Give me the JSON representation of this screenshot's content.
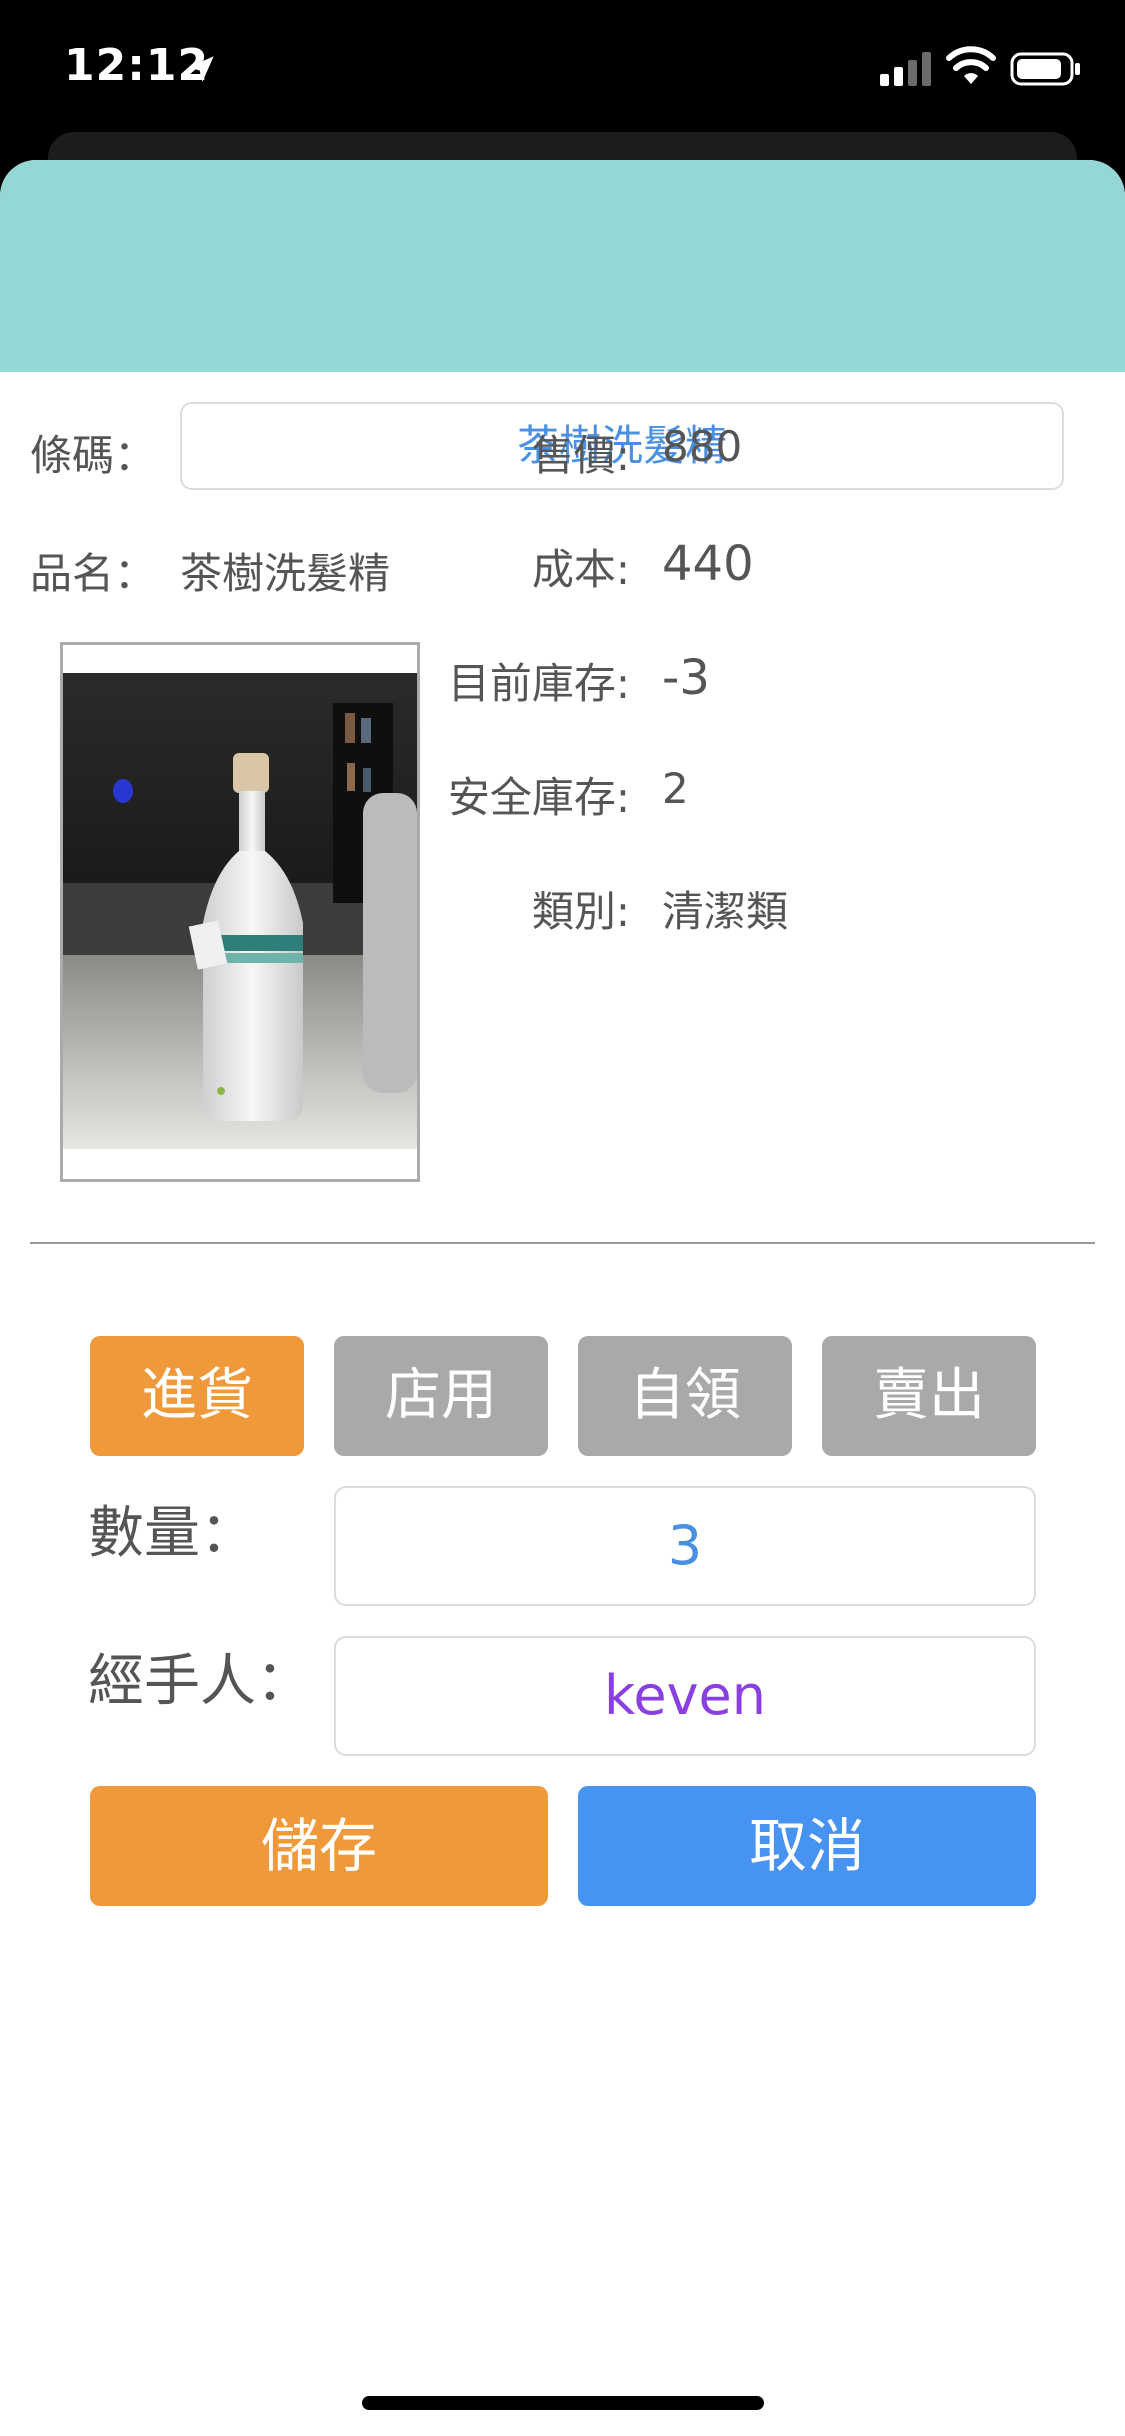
{
  "status_bar": {
    "time": "12:12"
  },
  "form": {
    "barcode_label": "條碼：",
    "barcode_value": "茶樹洗髮精",
    "name_label": "品名：",
    "name_value": "茶樹洗髮精"
  },
  "product_info": [
    {
      "key": "售價:",
      "value": "880"
    },
    {
      "key": "成本:",
      "value": "440"
    },
    {
      "key": "目前庫存:",
      "value": "-3"
    },
    {
      "key": "安全庫存:",
      "value": "2"
    },
    {
      "key": "類別:",
      "value": "清潔類"
    }
  ],
  "transaction_types": [
    {
      "label": "進貨",
      "selected": true
    },
    {
      "label": "店用",
      "selected": false
    },
    {
      "label": "自領",
      "selected": false
    },
    {
      "label": "賣出",
      "selected": false
    }
  ],
  "quantity": {
    "label": "數量：",
    "value": "3"
  },
  "handler": {
    "label": "經手人：",
    "value": "keven"
  },
  "actions": {
    "save_label": "儲存",
    "cancel_label": "取消"
  },
  "colors": {
    "header": "#94d7d4",
    "active_button": "#f0993a",
    "inactive_button": "#a9a9a9",
    "save_button": "#f0993a",
    "cancel_button": "#4793f2",
    "barcode_text": "#4a90e2",
    "quantity_text": "#4a90e2",
    "handler_text": "#8a3fe0"
  },
  "icons": {
    "location": "location-arrow-icon",
    "signal": "cellular-signal-icon",
    "wifi": "wifi-icon",
    "battery": "battery-icon"
  }
}
